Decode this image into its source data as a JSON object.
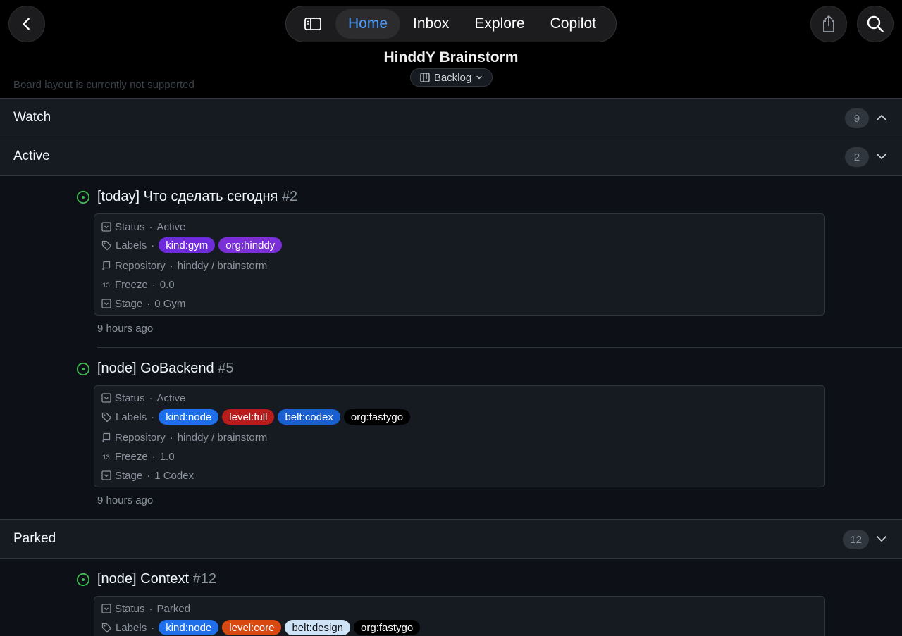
{
  "nav": {
    "tabs": [
      {
        "label": "Home",
        "active": true
      },
      {
        "label": "Inbox",
        "active": false
      },
      {
        "label": "Explore",
        "active": false
      },
      {
        "label": "Copilot",
        "active": false
      }
    ]
  },
  "header": {
    "title": "HinddY Brainstorm",
    "view_label": "Backlog",
    "board_note": "Board layout is currently not supported"
  },
  "groups": {
    "watch": {
      "name": "Watch",
      "count": "9",
      "expanded": false
    },
    "active": {
      "name": "Active",
      "count": "2",
      "expanded": true
    },
    "parked": {
      "name": "Parked",
      "count": "12",
      "expanded": true
    }
  },
  "field_labels": {
    "status": "Status",
    "labels": "Labels",
    "repository": "Repository",
    "freeze": "Freeze",
    "stage": "Stage",
    "sep": "·"
  },
  "items": [
    {
      "title": "[today] Что сделать сегодня",
      "number": "#2",
      "status": "Active",
      "labels": [
        {
          "name": "kind:gym",
          "bg": "#6e2bd9",
          "fg": "#ffffff"
        },
        {
          "name": "org:hinddy",
          "bg": "#7b2fd6",
          "fg": "#ffffff"
        }
      ],
      "repository": "hinddy / brainstorm",
      "freeze": "0.0",
      "stage": "0 Gym",
      "time": "9 hours ago"
    },
    {
      "title": "[node] GoBackend",
      "number": "#5",
      "status": "Active",
      "labels": [
        {
          "name": "kind:node",
          "bg": "#1f6feb",
          "fg": "#ffffff"
        },
        {
          "name": "level:full",
          "bg": "#b91c1c",
          "fg": "#ffffff"
        },
        {
          "name": "belt:codex",
          "bg": "#1a5fd0",
          "fg": "#ffffff"
        },
        {
          "name": "org:fastygo",
          "bg": "#000000",
          "fg": "#ffffff"
        }
      ],
      "repository": "hinddy / brainstorm",
      "freeze": "1.0",
      "stage": "1 Codex",
      "time": "9 hours ago"
    },
    {
      "title": "[node] Context",
      "number": "#12",
      "status": "Parked",
      "labels": [
        {
          "name": "kind:node",
          "bg": "#1f6feb",
          "fg": "#ffffff"
        },
        {
          "name": "level:core",
          "bg": "#d9480f",
          "fg": "#ffffff"
        },
        {
          "name": "belt:design",
          "bg": "#cfe3f7",
          "fg": "#0d1117"
        },
        {
          "name": "org:fastygo",
          "bg": "#000000",
          "fg": "#ffffff"
        }
      ]
    }
  ],
  "colors": {
    "accent": "#4c9dff",
    "open_issue": "#3fb950",
    "background": "#0d1117"
  }
}
